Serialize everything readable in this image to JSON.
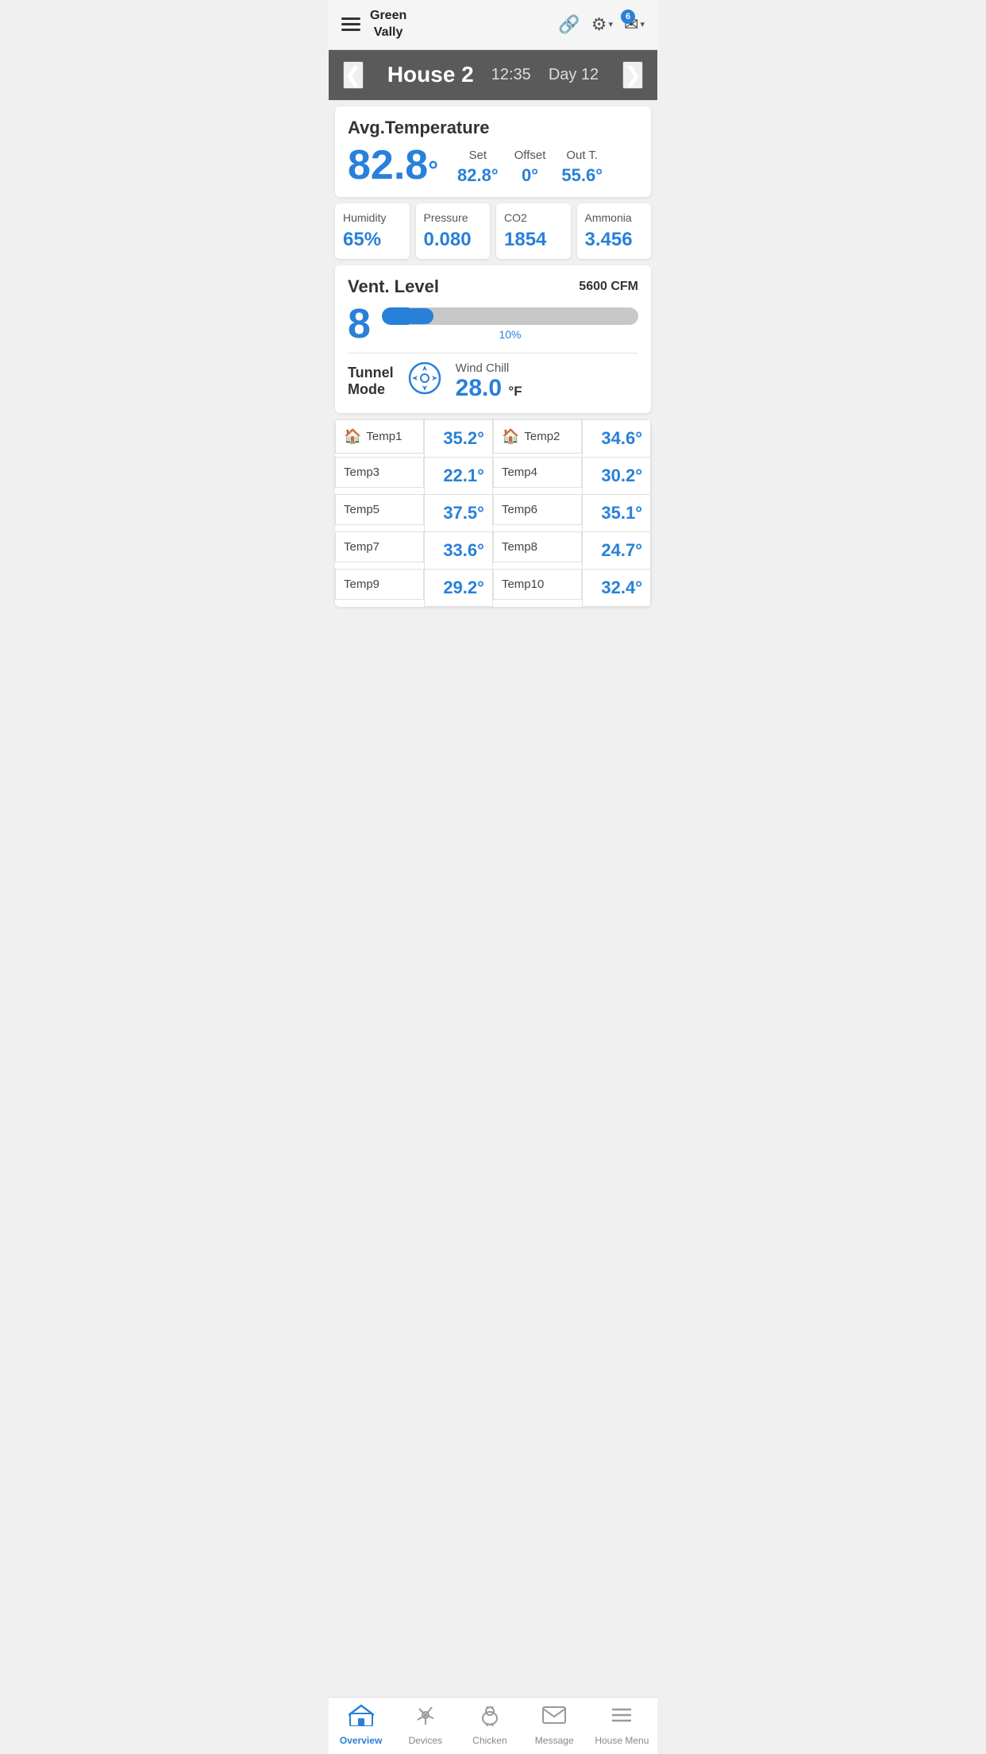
{
  "topNav": {
    "locationName": "Green\nVally",
    "locationLine1": "Green",
    "locationLine2": "Vally",
    "mailCount": "6"
  },
  "houseHeader": {
    "houseName": "House 2",
    "time": "12:35",
    "day": "Day 12",
    "prevBtn": "❮",
    "nextBtn": "❯"
  },
  "avgTemperature": {
    "label": "Avg.Temperature",
    "value": "82.8",
    "deg": "°",
    "setLabel": "Set",
    "setValue": "82.8°",
    "offsetLabel": "Offset",
    "offsetValue": "0°",
    "outTLabel": "Out T.",
    "outTValue": "55.6°"
  },
  "sensors": {
    "humidity": {
      "label": "Humidity",
      "value": "65%"
    },
    "pressure": {
      "label": "Pressure",
      "value": "0.080"
    },
    "co2": {
      "label": "CO2",
      "value": "1854"
    },
    "ammonia": {
      "label": "Ammonia",
      "value": "3.456"
    }
  },
  "ventLevel": {
    "title": "Vent. Level",
    "cfm": "5600 CFM",
    "level": "8",
    "percent": "10%",
    "sliderFillWidth": "13%",
    "tunnelModeLabel1": "Tunnel",
    "tunnelModeLabel2": "Mode",
    "windChillLabel": "Wind Chill",
    "windChillValue": "28.0",
    "windChillUnit": "°F"
  },
  "tempGrid": [
    {
      "name1": "Temp1",
      "val1": "35.2°",
      "icon1": true,
      "name2": "Temp2",
      "val2": "34.6°",
      "icon2": true
    },
    {
      "name1": "Temp3",
      "val1": "22.1°",
      "icon1": false,
      "name2": "Temp4",
      "val2": "30.2°",
      "icon2": false
    },
    {
      "name1": "Temp5",
      "val1": "37.5°",
      "icon1": false,
      "name2": "Temp6",
      "val2": "35.1°",
      "icon2": false
    },
    {
      "name1": "Temp7",
      "val1": "33.6°",
      "icon1": false,
      "name2": "Temp8",
      "val2": "24.7°",
      "icon2": false
    },
    {
      "name1": "Temp9",
      "val1": "29.2°",
      "icon1": false,
      "name2": "Temp10",
      "val2": "32.4°",
      "icon2": false
    }
  ],
  "bottomNav": {
    "items": [
      {
        "id": "overview",
        "label": "Overview",
        "icon": "🏠",
        "active": true
      },
      {
        "id": "devices",
        "label": "Devices",
        "icon": "✦",
        "active": false
      },
      {
        "id": "chicken",
        "label": "Chicken",
        "icon": "🐔",
        "active": false
      },
      {
        "id": "message",
        "label": "Message",
        "icon": "✉",
        "active": false
      },
      {
        "id": "house-menu",
        "label": "House Menu",
        "icon": "☰",
        "active": false
      }
    ]
  },
  "colors": {
    "blue": "#2980d9",
    "headerBg": "#5a5a5a",
    "red": "#cc3333"
  }
}
